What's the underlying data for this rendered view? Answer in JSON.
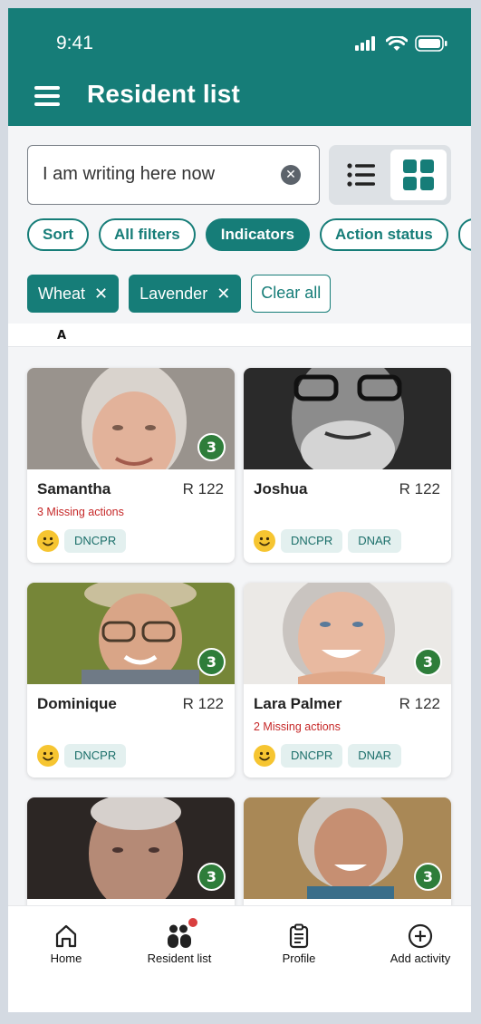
{
  "status_bar": {
    "time": "9:41"
  },
  "header": {
    "title": "Resident list"
  },
  "search": {
    "value": "I am writing here now"
  },
  "filter_chips": [
    {
      "label": "Sort",
      "active": false
    },
    {
      "label": "All filters",
      "active": false
    },
    {
      "label": "Indicators",
      "active": true
    },
    {
      "label": "Action status",
      "active": false
    }
  ],
  "active_filters": [
    {
      "label": "Wheat",
      "remove_glyph": "✕"
    },
    {
      "label": "Lavender",
      "remove_glyph": "✕"
    }
  ],
  "clear_all_label": "Clear all",
  "section_letter": "A",
  "residents": [
    {
      "name": "Samantha",
      "room": "R 122",
      "badge": "3",
      "missing": "3 Missing actions",
      "indicators": [
        "DNCPR"
      ]
    },
    {
      "name": "Joshua",
      "room": "R 122",
      "badge": "",
      "missing": "",
      "indicators": [
        "DNCPR",
        "DNAR"
      ]
    },
    {
      "name": "Dominique",
      "room": "R 122",
      "badge": "3",
      "missing": "",
      "indicators": [
        "DNCPR"
      ]
    },
    {
      "name": "Lara Palmer",
      "room": "R 122",
      "badge": "3",
      "missing": "2 Missing actions",
      "indicators": [
        "DNCPR",
        "DNAR"
      ]
    },
    {
      "name": "",
      "room": "",
      "badge": "3",
      "missing": "",
      "indicators": []
    },
    {
      "name": "",
      "room": "",
      "badge": "3",
      "missing": "",
      "indicators": []
    }
  ],
  "bottom_nav": [
    {
      "label": "Home",
      "icon": "home-icon"
    },
    {
      "label": "Resident list",
      "icon": "residents-icon",
      "notification": true
    },
    {
      "label": "Profile",
      "icon": "clipboard-icon"
    },
    {
      "label": "Add activity",
      "icon": "plus-circle-icon"
    }
  ],
  "colors": {
    "brand": "#167d78",
    "badge": "#2e7d3a",
    "alert": "#c62828",
    "smiley": "#f6c531"
  }
}
